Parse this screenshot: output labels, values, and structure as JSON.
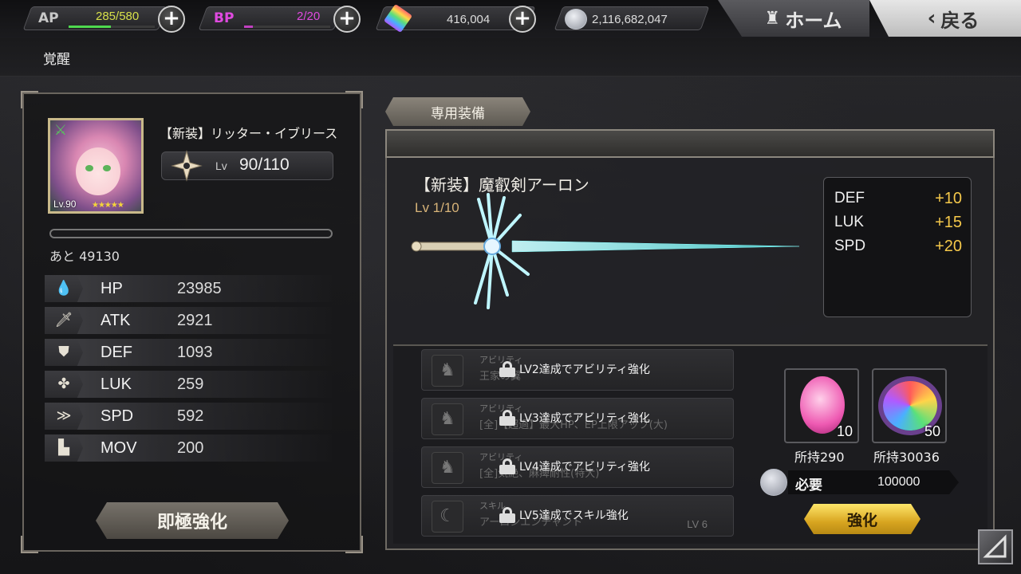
{
  "top_bar": {
    "ap": {
      "label": "AP",
      "value": "285/580",
      "current": 285,
      "max": 580
    },
    "bp": {
      "label": "BP",
      "value": "2/20",
      "current": 2,
      "max": 20
    },
    "gems": {
      "value": "416,004",
      "icon": "rainbow-crystal-icon"
    },
    "coins": {
      "value": "2,116,682,047",
      "icon": "silver-coin-icon"
    },
    "plus_label": "+",
    "home_label": "ホーム",
    "back_label": "戻る"
  },
  "page": {
    "title": "覚醒"
  },
  "character": {
    "name": "【新装】リッター・イブリース",
    "portrait_level": "Lv.90",
    "rarity_stars": "★★★★★",
    "lv_label": "Lv",
    "level": "90/110",
    "remaining": "あと 49130",
    "stats": [
      {
        "name": "HP",
        "value": "23985",
        "icon": "drop-icon",
        "glyph": "💧"
      },
      {
        "name": "ATK",
        "value": "2921",
        "icon": "sword-icon",
        "glyph": "🗡"
      },
      {
        "name": "DEF",
        "value": "1093",
        "icon": "shield-icon",
        "glyph": "⛊"
      },
      {
        "name": "LUK",
        "value": "259",
        "icon": "clover-icon",
        "glyph": "✤"
      },
      {
        "name": "SPD",
        "value": "592",
        "icon": "speed-icon",
        "glyph": "≫"
      },
      {
        "name": "MOV",
        "value": "200",
        "icon": "boot-icon",
        "glyph": "▙"
      }
    ],
    "limit_button": "即極強化"
  },
  "equipment": {
    "tab_label": "専用装備",
    "name": "【新装】魔叡剣アーロン",
    "level": "Lv 1/10",
    "bonuses": [
      {
        "name": "DEF",
        "value": "+10"
      },
      {
        "name": "LUK",
        "value": "+15"
      },
      {
        "name": "SPD",
        "value": "+20"
      }
    ],
    "abilities": [
      {
        "type": "アビリティ",
        "sub": "王家の翼",
        "lock_text": "LV2達成でアビリティ強化",
        "level": ""
      },
      {
        "type": "アビリティ",
        "sub": "[全]【超過】最大HP、EP上限アップ(大)",
        "lock_text": "LV3達成でアビリティ強化",
        "level": ""
      },
      {
        "type": "アビリティ",
        "sub": "[全]気絶、麻痺耐性(特大)",
        "lock_text": "LV4達成でアビリティ強化",
        "level": ""
      },
      {
        "type": "スキル",
        "sub": "アーロンエンチャント",
        "lock_text": "LV5達成でスキル強化",
        "level": "LV 6"
      }
    ],
    "materials": [
      {
        "count": "10",
        "owned": "所持290",
        "icon": "pink-gem-icon"
      },
      {
        "count": "50",
        "owned": "所持30036",
        "icon": "rainbow-orb-icon"
      }
    ],
    "need_label": "必要",
    "need_value": "100000",
    "enhance_button": "強化"
  }
}
